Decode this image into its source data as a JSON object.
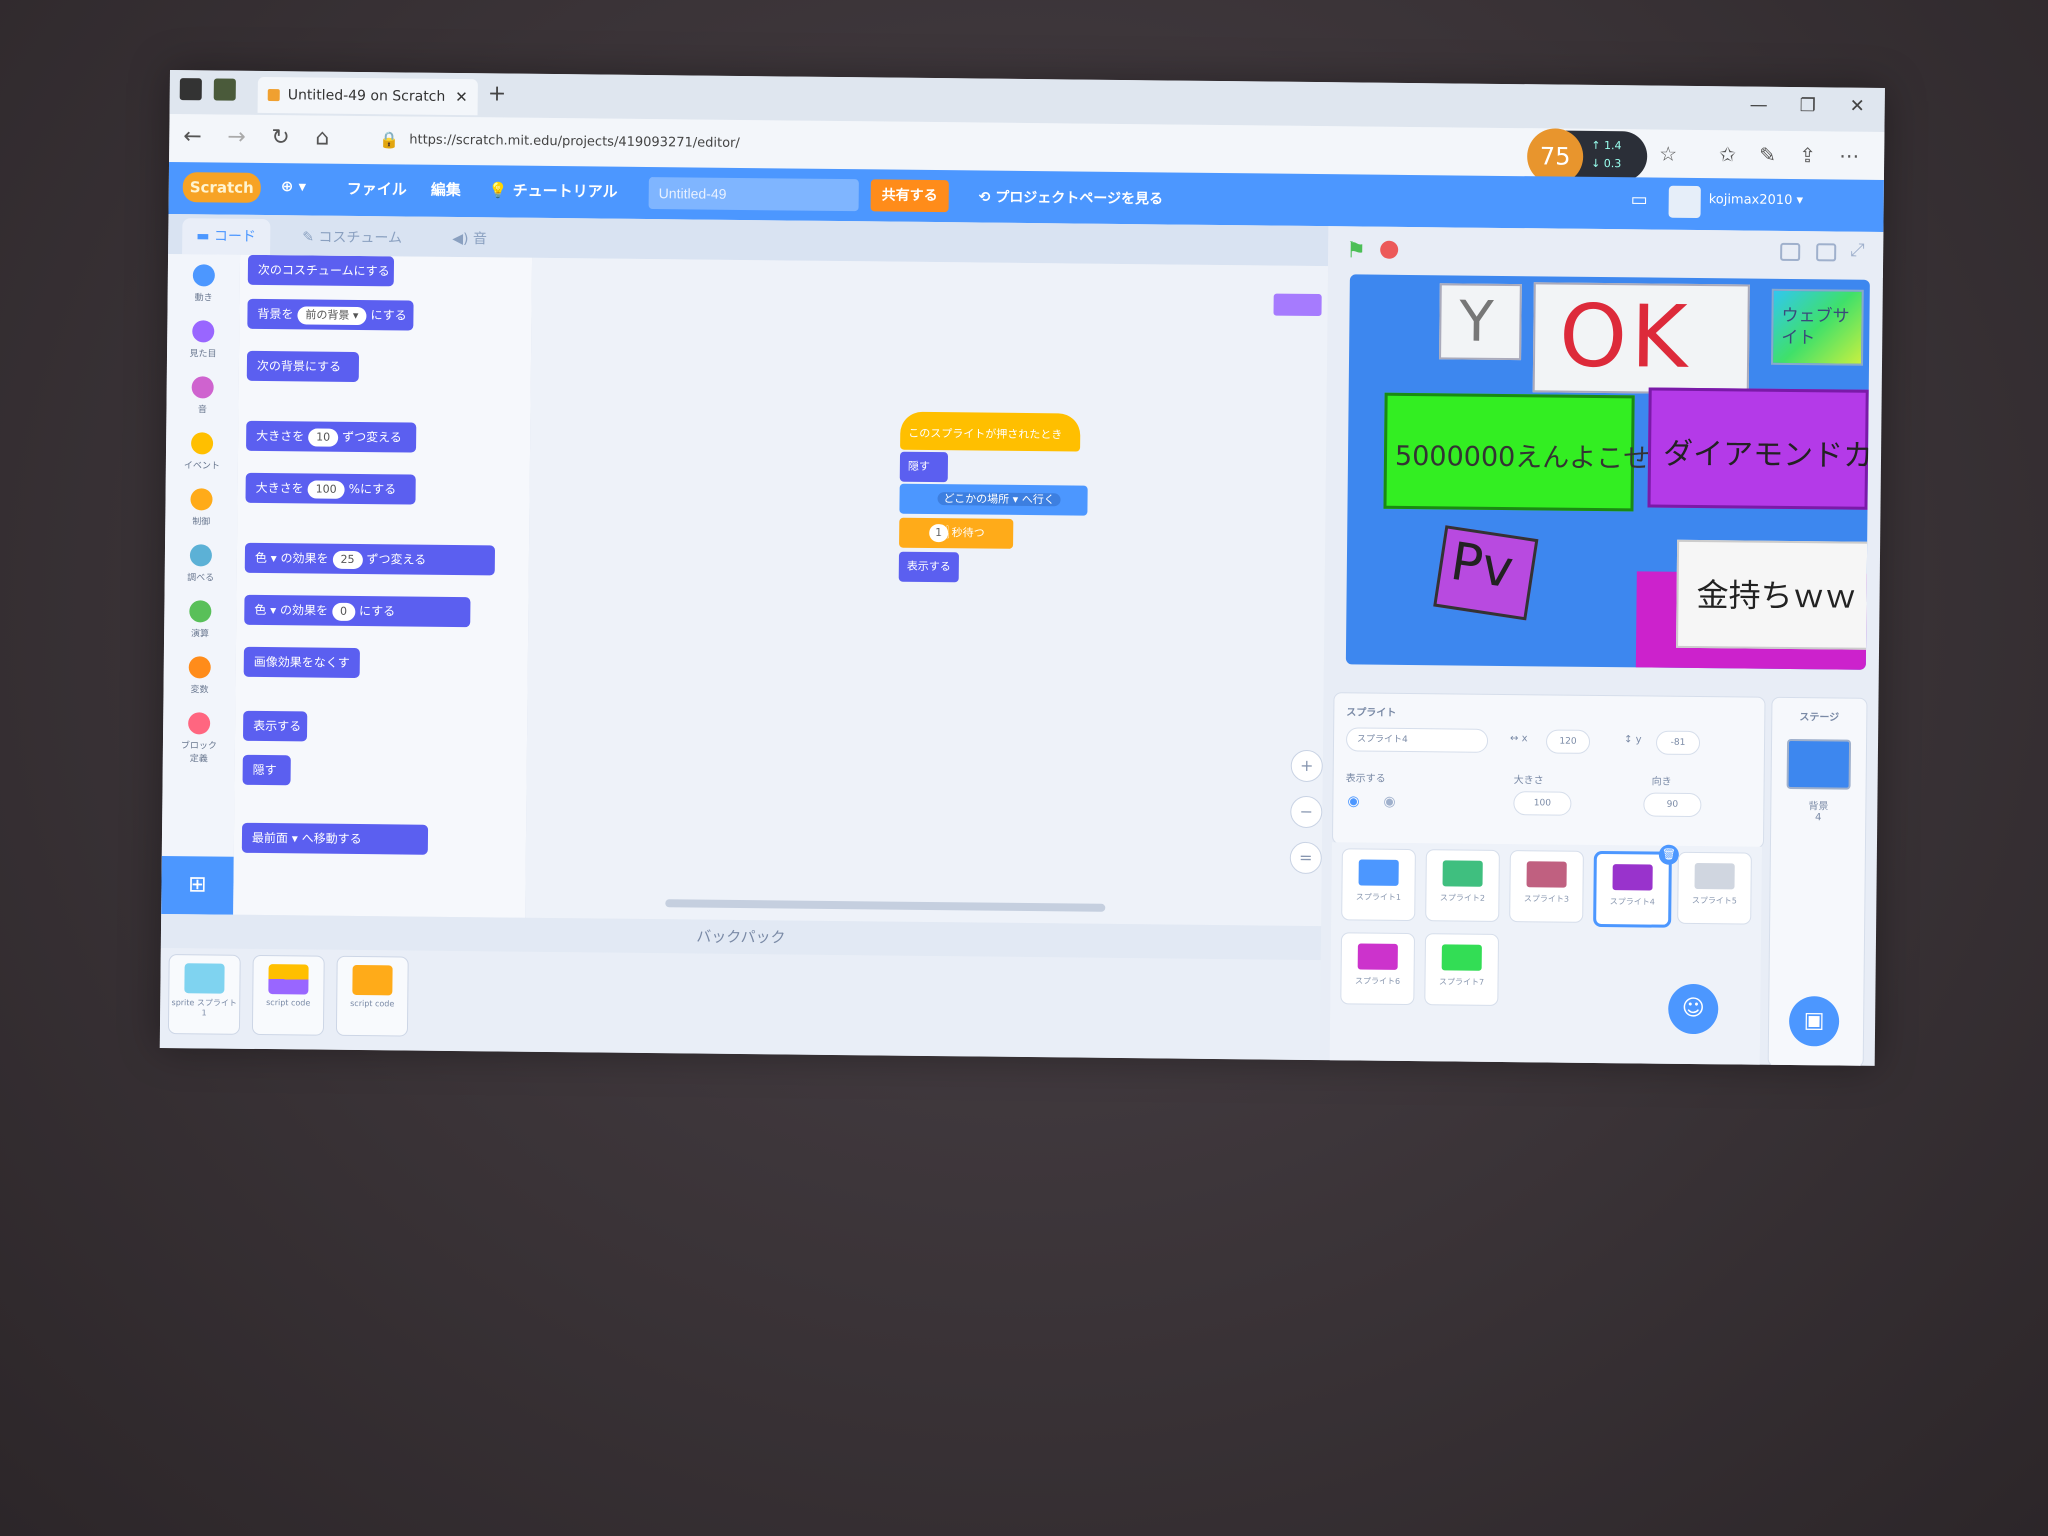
{
  "browser": {
    "tab_title": "Untitled-49 on Scratch",
    "url": "https://scratch.mit.edu/projects/419093271/editor/",
    "perf_percent": "75",
    "perf_up": "1.4",
    "perf_down": "0.3"
  },
  "menubar": {
    "logo": "Scratch",
    "language_icon": "globe-icon",
    "file": "ファイル",
    "edit": "編集",
    "tutorials": "チュートリアル",
    "project_title": "Untitled-49",
    "share": "共有する",
    "see_project_page": "プロジェクトページを見る",
    "username": "kojimax2010"
  },
  "tabs": {
    "code": "コード",
    "costumes": "コスチューム",
    "sounds": "音"
  },
  "categories": [
    {
      "label": "動き",
      "color": "#4c97ff"
    },
    {
      "label": "見た目",
      "color": "#9966ff"
    },
    {
      "label": "音",
      "color": "#cf63cf"
    },
    {
      "label": "イベント",
      "color": "#ffbf00"
    },
    {
      "label": "制御",
      "color": "#ffab19"
    },
    {
      "label": "調べる",
      "color": "#5cb1d6"
    },
    {
      "label": "演算",
      "color": "#59c059"
    },
    {
      "label": "変数",
      "color": "#ff8c1a"
    },
    {
      "label": "ブロック定義",
      "color": "#ff6680"
    }
  ],
  "palette_blocks": [
    {
      "text": "次のコスチュームにする"
    },
    {
      "text": "背景を",
      "pill": "前の背景 ▾",
      "suffix": "にする"
    },
    {
      "text": "次の背景にする"
    },
    {
      "text": "大きさを",
      "pill": "10",
      "suffix": "ずつ変える"
    },
    {
      "text": "大きさを",
      "pill": "100",
      "suffix": "%にする"
    },
    {
      "text": "色 ▾ の効果を",
      "pill": "25",
      "suffix": "ずつ変える"
    },
    {
      "text": "色 ▾ の効果を",
      "pill": "0",
      "suffix": "にする"
    },
    {
      "text": "画像効果をなくす"
    },
    {
      "text": "表示する"
    },
    {
      "text": "隠す"
    },
    {
      "text": "最前面 ▾ へ移動する"
    }
  ],
  "script": {
    "hat": "このスプライトが押されたとき",
    "hide": "隠す",
    "goto": "どこかの場所 ▾ へ行く",
    "wait_value": "1",
    "wait_suffix": "秒待つ",
    "show": "表示する"
  },
  "backpack": {
    "label": "バックパック",
    "items": [
      "sprite スプライト1",
      "script code",
      "script code"
    ]
  },
  "stage": {
    "y_sign": "Y",
    "ok_sign": "OK",
    "website_sign": "ウェブサイト",
    "green_box": "5000000えんよこせ",
    "purple_box": "ダイアモンドカード",
    "p_sign": "Pv",
    "rich_text": "金持ちｗｗ"
  },
  "sprite_info": {
    "header": "スプライト",
    "name": "スプライト4",
    "x_value": "120",
    "y_value": "-81",
    "show_label": "表示する",
    "size_label": "大きさ",
    "size_value": "100",
    "direction_label": "向き",
    "direction_value": "90"
  },
  "sprites": [
    {
      "label": "スプライト1",
      "color": "#4c97ff"
    },
    {
      "label": "スプライト2",
      "color": "#3fbf7f"
    },
    {
      "label": "スプライト3",
      "color": "#c06080"
    },
    {
      "label": "スプライト4",
      "color": "#9933cc"
    },
    {
      "label": "スプライト5",
      "color": "#d0d6e0"
    },
    {
      "label": "スプライト6",
      "color": "#cc33cc"
    },
    {
      "label": "スプライト7",
      "color": "#33dd55"
    }
  ],
  "stage_panel": {
    "label": "ステージ",
    "backdrops_label": "背景",
    "backdrops_count": "4"
  }
}
